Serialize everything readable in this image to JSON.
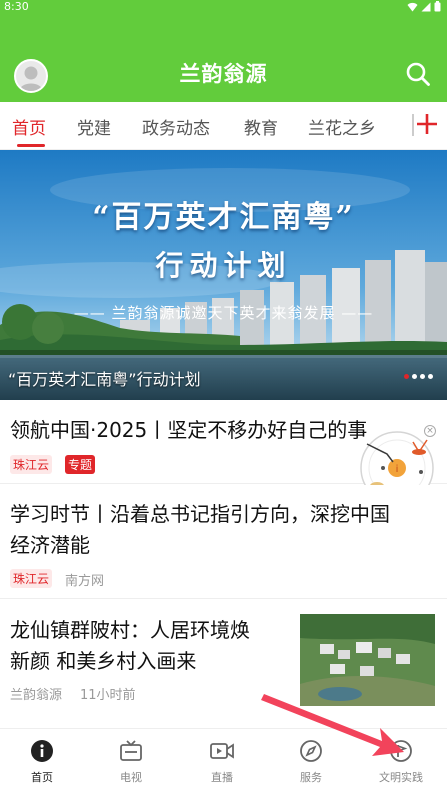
{
  "status_bar": {
    "time": "8:30"
  },
  "app": {
    "title": "兰韵翁源"
  },
  "tabs": [
    "首页",
    "党建",
    "政务动态",
    "教育",
    "兰花之乡"
  ],
  "banner": {
    "headline": "“百万英才汇南粤”",
    "subheadline": "行动计划",
    "slogan": "—— 兰韵翁源诚邀天下英才来翁发展 ——",
    "caption": "“百万英才汇南粤”行动计划",
    "slide_count": 4,
    "active_slide": 1
  },
  "news": [
    {
      "title": "领航中国·2025丨坚定不移办好自己的事",
      "tags": [
        "珠江云",
        "专题"
      ]
    },
    {
      "title_line1": "学习时节丨沿着总书记指引方向，深挖中国",
      "title_line2": "经济潜能",
      "source_tag": "珠江云",
      "source": "南方网"
    },
    {
      "title_line1": "龙仙镇群陂村：人居环境焕",
      "title_line2": "新颜 和美乡村入画来",
      "source": "兰韵翁源",
      "time": "11小时前"
    }
  ],
  "bottom_nav": [
    "首页",
    "电视",
    "直播",
    "服务",
    "文明实践"
  ],
  "colors": {
    "brand_green": "#62cc3c",
    "accent_red": "#e0262a",
    "annotation_arrow": "#f2435b"
  }
}
